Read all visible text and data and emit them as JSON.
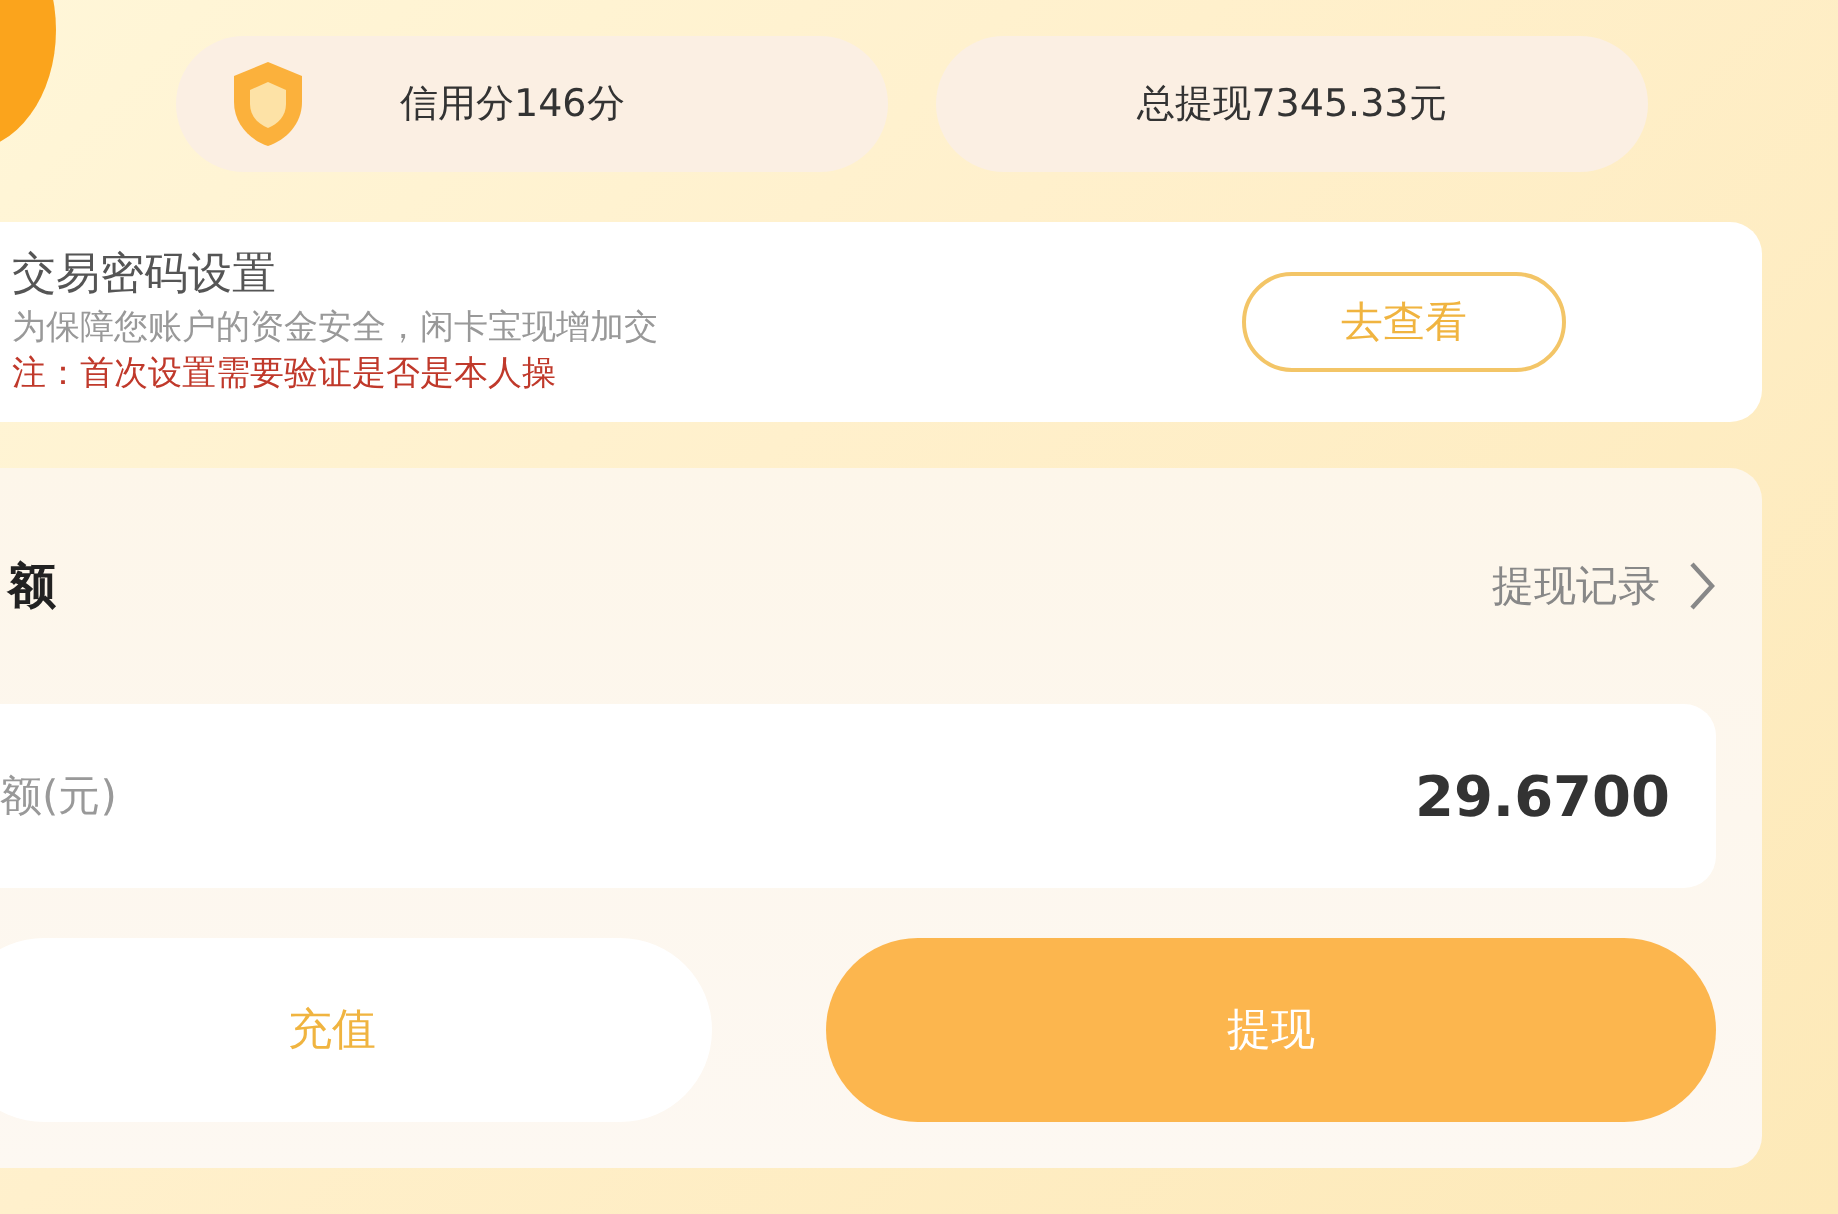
{
  "header": {
    "credit_score": "信用分146分",
    "total_withdrawn": "总提现7345.33元"
  },
  "trade_password": {
    "title": "交易密码设置",
    "description": "为保障您账户的资金安全，闲卡宝现增加交",
    "notice": "注：首次设置需要验证是否是本人操",
    "button": "去查看"
  },
  "balance": {
    "title": "额",
    "history_link": "提现记录",
    "label": "额(元)",
    "amount": "29.6700",
    "buttons": [
      {
        "label": "充值",
        "kind": "secondary"
      },
      {
        "label": "提现",
        "kind": "primary"
      }
    ]
  }
}
